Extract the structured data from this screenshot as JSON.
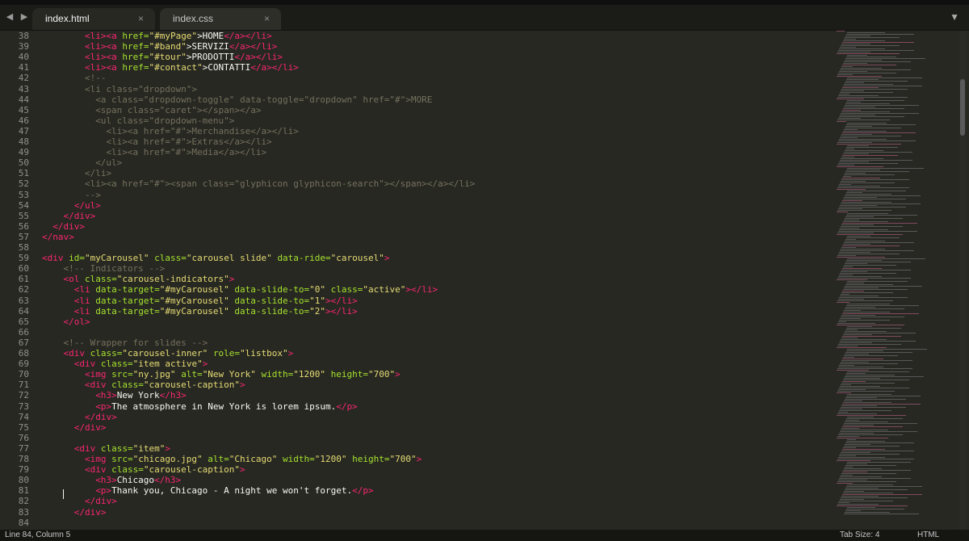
{
  "tabs": [
    {
      "label": "index.html",
      "active": true
    },
    {
      "label": "index.css",
      "active": false
    }
  ],
  "close_glyph": "×",
  "status": {
    "position": "Line 84, Column 5",
    "tab_size": "Tab Size: 4",
    "syntax": "HTML"
  },
  "colors": {
    "background": "#272822",
    "tag": "#f92672",
    "attribute": "#a6e22e",
    "string": "#e6db74",
    "comment": "#75715e",
    "text": "#f8f8f2"
  },
  "lines": [
    {
      "n": "38",
      "indent": 4,
      "segs": [
        [
          "tg",
          "<li>"
        ],
        [
          "tg",
          "<a "
        ],
        [
          "at",
          "href="
        ],
        [
          "st",
          "\"#myPage\""
        ],
        [
          "tx",
          ">HOME"
        ],
        [
          "tg",
          "</a>"
        ],
        [
          "tg",
          "</li>"
        ]
      ]
    },
    {
      "n": "39",
      "indent": 4,
      "segs": [
        [
          "tg",
          "<li>"
        ],
        [
          "tg",
          "<a "
        ],
        [
          "at",
          "href="
        ],
        [
          "st",
          "\"#band\""
        ],
        [
          "tx",
          ">SERVIZI"
        ],
        [
          "tg",
          "</a>"
        ],
        [
          "tg",
          "</li>"
        ]
      ]
    },
    {
      "n": "40",
      "indent": 4,
      "segs": [
        [
          "tg",
          "<li>"
        ],
        [
          "tg",
          "<a "
        ],
        [
          "at",
          "href="
        ],
        [
          "st",
          "\"#tour\""
        ],
        [
          "tx",
          ">PRODOTTI"
        ],
        [
          "tg",
          "</a>"
        ],
        [
          "tg",
          "</li>"
        ]
      ]
    },
    {
      "n": "41",
      "indent": 4,
      "segs": [
        [
          "tg",
          "<li>"
        ],
        [
          "tg",
          "<a "
        ],
        [
          "at",
          "href="
        ],
        [
          "st",
          "\"#contact\""
        ],
        [
          "tx",
          ">CONTATTI"
        ],
        [
          "tg",
          "</a>"
        ],
        [
          "tg",
          "</li>"
        ]
      ]
    },
    {
      "n": "42",
      "indent": 4,
      "segs": [
        [
          "cm",
          "<!--"
        ]
      ]
    },
    {
      "n": "43",
      "indent": 4,
      "segs": [
        [
          "cm",
          "<li class=\"dropdown\">"
        ]
      ]
    },
    {
      "n": "44",
      "indent": 5,
      "segs": [
        [
          "cm",
          "<a class=\"dropdown-toggle\" data-toggle=\"dropdown\" href=\"#\">MORE"
        ]
      ]
    },
    {
      "n": "45",
      "indent": 5,
      "segs": [
        [
          "cm",
          "<span class=\"caret\"></span></a>"
        ]
      ]
    },
    {
      "n": "46",
      "indent": 5,
      "segs": [
        [
          "cm",
          "<ul class=\"dropdown-menu\">"
        ]
      ]
    },
    {
      "n": "47",
      "indent": 6,
      "segs": [
        [
          "cm",
          "<li><a href=\"#\">Merchandise</a></li>"
        ]
      ]
    },
    {
      "n": "48",
      "indent": 6,
      "segs": [
        [
          "cm",
          "<li><a href=\"#\">Extras</a></li>"
        ]
      ]
    },
    {
      "n": "49",
      "indent": 6,
      "segs": [
        [
          "cm",
          "<li><a href=\"#\">Media</a></li>"
        ]
      ]
    },
    {
      "n": "50",
      "indent": 5,
      "segs": [
        [
          "cm",
          "</ul>"
        ]
      ]
    },
    {
      "n": "51",
      "indent": 4,
      "segs": [
        [
          "cm",
          "</li>"
        ]
      ]
    },
    {
      "n": "52",
      "indent": 4,
      "segs": [
        [
          "cm",
          "<li><a href=\"#\"><span class=\"glyphicon glyphicon-search\"></span></a></li>"
        ]
      ]
    },
    {
      "n": "53",
      "indent": 4,
      "segs": [
        [
          "cm",
          "-->"
        ]
      ]
    },
    {
      "n": "54",
      "indent": 3,
      "segs": [
        [
          "tg",
          "</ul>"
        ]
      ]
    },
    {
      "n": "55",
      "indent": 2,
      "segs": [
        [
          "tg",
          "</div>"
        ]
      ]
    },
    {
      "n": "56",
      "indent": 1,
      "segs": [
        [
          "tg",
          "</div>"
        ]
      ]
    },
    {
      "n": "57",
      "indent": 0,
      "segs": [
        [
          "tg",
          "</nav>"
        ]
      ]
    },
    {
      "n": "58",
      "indent": 0,
      "segs": []
    },
    {
      "n": "59",
      "indent": 0,
      "segs": [
        [
          "tg",
          "<div "
        ],
        [
          "at",
          "id="
        ],
        [
          "st",
          "\"myCarousel\" "
        ],
        [
          "at",
          "class="
        ],
        [
          "st",
          "\"carousel slide\" "
        ],
        [
          "at",
          "data-ride="
        ],
        [
          "st",
          "\"carousel\""
        ],
        [
          "tg",
          ">"
        ]
      ]
    },
    {
      "n": "60",
      "indent": 2,
      "segs": [
        [
          "cm",
          "<!-- Indicators -->"
        ]
      ]
    },
    {
      "n": "61",
      "indent": 2,
      "segs": [
        [
          "tg",
          "<ol "
        ],
        [
          "at",
          "class="
        ],
        [
          "st",
          "\"carousel-indicators\""
        ],
        [
          "tg",
          ">"
        ]
      ]
    },
    {
      "n": "62",
      "indent": 3,
      "segs": [
        [
          "tg",
          "<li "
        ],
        [
          "at",
          "data-target="
        ],
        [
          "st",
          "\"#myCarousel\" "
        ],
        [
          "at",
          "data-slide-to="
        ],
        [
          "st",
          "\"0\" "
        ],
        [
          "at",
          "class="
        ],
        [
          "st",
          "\"active\""
        ],
        [
          "tg",
          "></li>"
        ]
      ]
    },
    {
      "n": "63",
      "indent": 3,
      "segs": [
        [
          "tg",
          "<li "
        ],
        [
          "at",
          "data-target="
        ],
        [
          "st",
          "\"#myCarousel\" "
        ],
        [
          "at",
          "data-slide-to="
        ],
        [
          "st",
          "\"1\""
        ],
        [
          "tg",
          "></li>"
        ]
      ]
    },
    {
      "n": "64",
      "indent": 3,
      "segs": [
        [
          "tg",
          "<li "
        ],
        [
          "at",
          "data-target="
        ],
        [
          "st",
          "\"#myCarousel\" "
        ],
        [
          "at",
          "data-slide-to="
        ],
        [
          "st",
          "\"2\""
        ],
        [
          "tg",
          "></li>"
        ]
      ]
    },
    {
      "n": "65",
      "indent": 2,
      "segs": [
        [
          "tg",
          "</ol>"
        ]
      ]
    },
    {
      "n": "66",
      "indent": 0,
      "segs": []
    },
    {
      "n": "67",
      "indent": 2,
      "segs": [
        [
          "cm",
          "<!-- Wrapper for slides -->"
        ]
      ]
    },
    {
      "n": "68",
      "indent": 2,
      "segs": [
        [
          "tg",
          "<div "
        ],
        [
          "at",
          "class="
        ],
        [
          "st",
          "\"carousel-inner\" "
        ],
        [
          "at",
          "role="
        ],
        [
          "st",
          "\"listbox\""
        ],
        [
          "tg",
          ">"
        ]
      ]
    },
    {
      "n": "69",
      "indent": 3,
      "segs": [
        [
          "tg",
          "<div "
        ],
        [
          "at",
          "class="
        ],
        [
          "st",
          "\"item active\""
        ],
        [
          "tg",
          ">"
        ]
      ]
    },
    {
      "n": "70",
      "indent": 4,
      "segs": [
        [
          "tg",
          "<img "
        ],
        [
          "at",
          "src="
        ],
        [
          "st",
          "\"ny.jpg\" "
        ],
        [
          "at",
          "alt="
        ],
        [
          "st",
          "\"New York\" "
        ],
        [
          "at",
          "width="
        ],
        [
          "st",
          "\"1200\" "
        ],
        [
          "at",
          "height="
        ],
        [
          "st",
          "\"700\""
        ],
        [
          "tg",
          ">"
        ]
      ]
    },
    {
      "n": "71",
      "indent": 4,
      "segs": [
        [
          "tg",
          "<div "
        ],
        [
          "at",
          "class="
        ],
        [
          "st",
          "\"carousel-caption\""
        ],
        [
          "tg",
          ">"
        ]
      ]
    },
    {
      "n": "72",
      "indent": 5,
      "segs": [
        [
          "tg",
          "<h3>"
        ],
        [
          "tx",
          "New York"
        ],
        [
          "tg",
          "</h3>"
        ]
      ]
    },
    {
      "n": "73",
      "indent": 5,
      "segs": [
        [
          "tg",
          "<p>"
        ],
        [
          "tx",
          "The atmosphere in New York is lorem ipsum."
        ],
        [
          "tg",
          "</p>"
        ]
      ]
    },
    {
      "n": "74",
      "indent": 4,
      "segs": [
        [
          "tg",
          "</div>"
        ]
      ]
    },
    {
      "n": "75",
      "indent": 3,
      "segs": [
        [
          "tg",
          "</div>"
        ]
      ]
    },
    {
      "n": "76",
      "indent": 0,
      "segs": []
    },
    {
      "n": "77",
      "indent": 3,
      "segs": [
        [
          "tg",
          "<div "
        ],
        [
          "at",
          "class="
        ],
        [
          "st",
          "\"item\""
        ],
        [
          "tg",
          ">"
        ]
      ]
    },
    {
      "n": "78",
      "indent": 4,
      "segs": [
        [
          "tg",
          "<img "
        ],
        [
          "at",
          "src="
        ],
        [
          "st",
          "\"chicago.jpg\" "
        ],
        [
          "at",
          "alt="
        ],
        [
          "st",
          "\"Chicago\" "
        ],
        [
          "at",
          "width="
        ],
        [
          "st",
          "\"1200\" "
        ],
        [
          "at",
          "height="
        ],
        [
          "st",
          "\"700\""
        ],
        [
          "tg",
          ">"
        ]
      ]
    },
    {
      "n": "79",
      "indent": 4,
      "segs": [
        [
          "tg",
          "<div "
        ],
        [
          "at",
          "class="
        ],
        [
          "st",
          "\"carousel-caption\""
        ],
        [
          "tg",
          ">"
        ]
      ]
    },
    {
      "n": "80",
      "indent": 5,
      "segs": [
        [
          "tg",
          "<h3>"
        ],
        [
          "tx",
          "Chicago"
        ],
        [
          "tg",
          "</h3>"
        ]
      ]
    },
    {
      "n": "81",
      "indent": 5,
      "segs": [
        [
          "tg",
          "<p>"
        ],
        [
          "tx",
          "Thank you, Chicago - A night we won't forget."
        ],
        [
          "tg",
          "</p>"
        ]
      ]
    },
    {
      "n": "82",
      "indent": 4,
      "segs": [
        [
          "tg",
          "</div>"
        ]
      ]
    },
    {
      "n": "83",
      "indent": 3,
      "segs": [
        [
          "tg",
          "</div>"
        ]
      ]
    },
    {
      "n": "84",
      "indent": 0,
      "segs": []
    }
  ]
}
